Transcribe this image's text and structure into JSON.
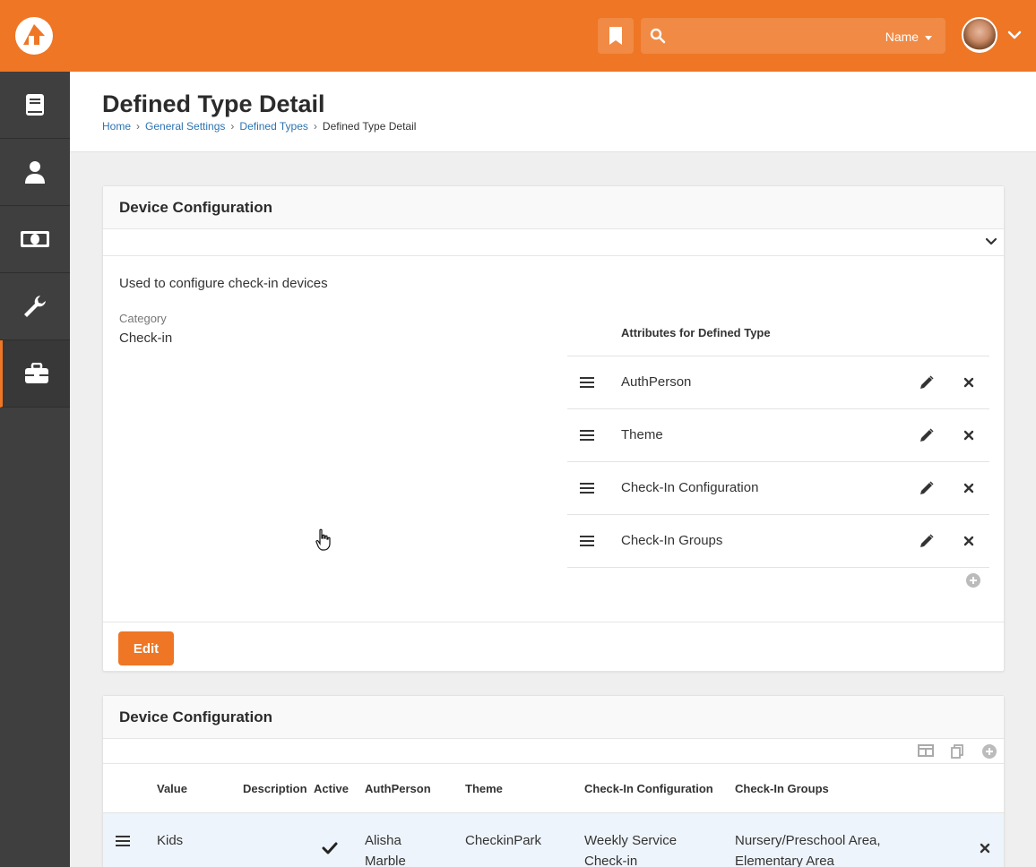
{
  "header": {
    "search_filter": "Name",
    "search_placeholder": ""
  },
  "page": {
    "title": "Defined Type Detail",
    "breadcrumbs": [
      "Home",
      "General Settings",
      "Defined Types",
      "Defined Type Detail"
    ]
  },
  "detail_panel": {
    "title": "Device Configuration",
    "description": "Used to configure check-in devices",
    "category_label": "Category",
    "category_value": "Check-in",
    "attributes_header": "Attributes for Defined Type",
    "attributes": [
      "AuthPerson",
      "Theme",
      "Check-In Configuration",
      "Check-In Groups"
    ],
    "edit_label": "Edit"
  },
  "values_panel": {
    "title": "Device Configuration",
    "columns": [
      "Value",
      "Description",
      "Active",
      "AuthPerson",
      "Theme",
      "Check-In Configuration",
      "Check-In Groups"
    ],
    "rows": [
      {
        "value": "Kids",
        "description": "",
        "active": true,
        "authperson_line1": "Alisha",
        "authperson_line2": "Marble",
        "theme": "CheckinPark",
        "config_line1": "Weekly Service",
        "config_line2": "Check-in",
        "groups_line1": "Nursery/Preschool Area,",
        "groups_line2": "Elementary Area"
      }
    ]
  },
  "colors": {
    "brand_orange": "#ee7625",
    "sidebar": "#3f3f3f",
    "link": "#2c73b1"
  },
  "icons": [
    "rock-logo-icon",
    "bookmark-icon",
    "search-icon",
    "caret-down-icon",
    "chevron-down-icon",
    "book-icon",
    "person-icon",
    "money-icon",
    "wrench-icon",
    "briefcase-icon",
    "drag-handle-icon",
    "pencil-icon",
    "close-icon",
    "plus-circle-icon",
    "grid-icon",
    "copy-icon",
    "check-icon",
    "hand-cursor-icon"
  ]
}
